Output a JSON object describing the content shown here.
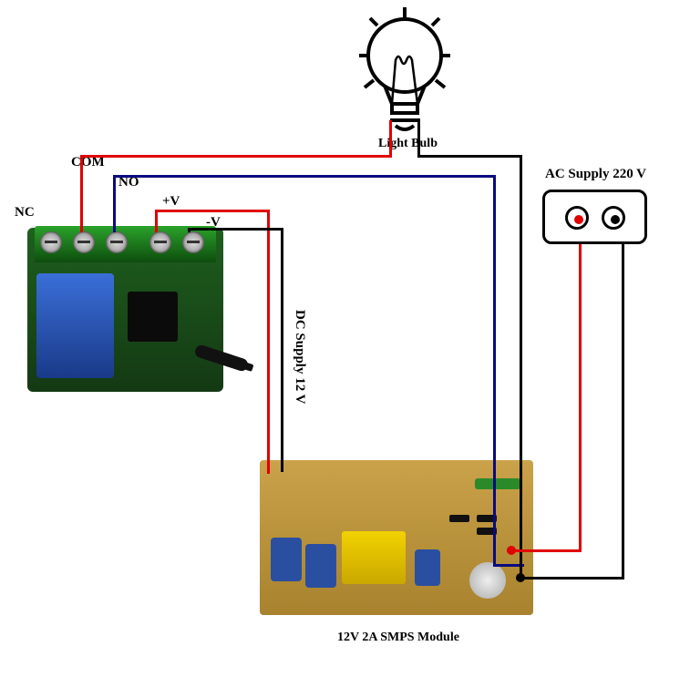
{
  "labels": {
    "com": "COM",
    "no": "NO",
    "nc": "NC",
    "vplus": "+V",
    "vminus": "-V",
    "bulb": "Light Bulb",
    "ac": "AC Supply 220 V",
    "dc": "DC Supply 12 V",
    "smps": "12V 2A SMPS Module"
  },
  "components": {
    "relay": "RF Relay Module (SRD-12VDC-SL-C)",
    "smps": "12V 2A SMPS Power Supply Board",
    "socket": "220V AC Mains Socket",
    "bulb": "Light Bulb (Load)"
  },
  "wiring": {
    "com_to_bulb": "red",
    "no_to_ac_neutral": "blue",
    "bulb_to_ac_hot": "black",
    "vplus_to_smps": "red",
    "vminus_to_smps": "black",
    "ac_hot_to_smps": "red",
    "ac_neutral_to_smps": "black"
  },
  "supply": {
    "ac_voltage": "220 V",
    "dc_voltage": "12 V",
    "dc_current": "2 A"
  }
}
